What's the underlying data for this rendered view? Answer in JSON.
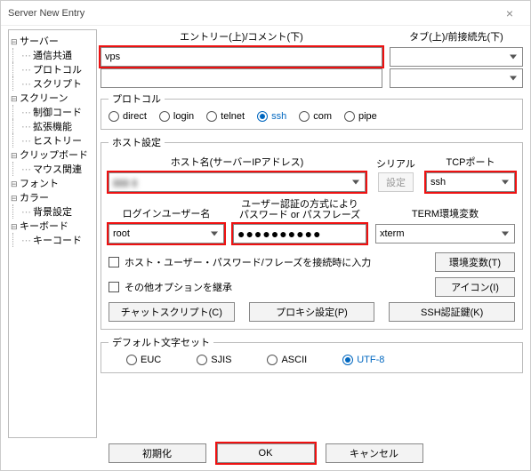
{
  "window": {
    "title": "Server New Entry"
  },
  "tree": {
    "server": "サーバー",
    "server_children": [
      "通信共通",
      "プロトコル",
      "スクリプト"
    ],
    "screen": "スクリーン",
    "screen_children": [
      "制御コード",
      "拡張機能",
      "ヒストリー"
    ],
    "clipboard": "クリップボード",
    "clipboard_children": [
      "マウス関連"
    ],
    "font": "フォント",
    "color": "カラー",
    "color_children": [
      "背景設定"
    ],
    "keyboard": "キーボード",
    "keyboard_children": [
      "キーコード"
    ]
  },
  "entry": {
    "left_label": "エントリー(上)/コメント(下)",
    "right_label": "タブ(上)/前接続先(下)",
    "name": "vps",
    "comment": "",
    "tab": "",
    "prev": ""
  },
  "protocol": {
    "legend": "プロトコル",
    "options": [
      "direct",
      "login",
      "telnet",
      "ssh",
      "com",
      "pipe"
    ],
    "selected": "ssh"
  },
  "host": {
    "legend": "ホスト設定",
    "hostname_label": "ホスト名(サーバーIPアドレス)",
    "hostname": "▮▮▮ ▮",
    "serial_label": "シリアル",
    "serial_btn": "設定",
    "tcpport_label": "TCPポート",
    "tcpport": "ssh",
    "login_label": "ログインユーザー名",
    "login": "root",
    "auth_label1": "ユーザー認証の方式により",
    "auth_label2": "パスワード or パスフレーズ",
    "password_mask": "●●●●●●●●●●",
    "term_label": "TERM環境変数",
    "term": "xterm",
    "chk_remember": "ホスト・ユーザー・パスワード/フレーズを接続時に入力",
    "chk_inherit": "その他オプションを継承",
    "btn_env": "環境変数(T)",
    "btn_icon": "アイコン(I)",
    "btn_chat": "チャットスクリプト(C)",
    "btn_proxy": "プロキシ設定(P)",
    "btn_sshkey": "SSH認証鍵(K)"
  },
  "charset": {
    "legend": "デフォルト文字セット",
    "options": [
      "EUC",
      "SJIS",
      "ASCII",
      "UTF-8"
    ],
    "selected": "UTF-8"
  },
  "footer": {
    "reset": "初期化",
    "ok": "OK",
    "cancel": "キャンセル"
  }
}
